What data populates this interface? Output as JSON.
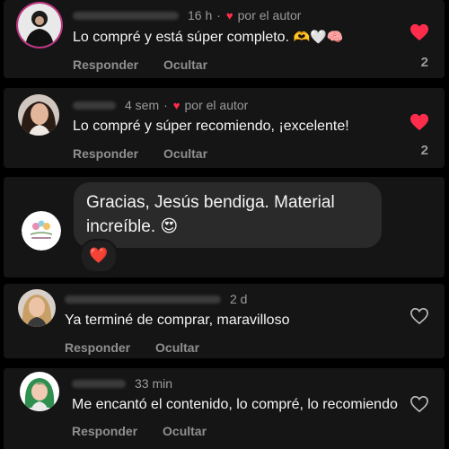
{
  "comments": [
    {
      "time": "16 h",
      "author_note": "por el autor",
      "text": "Lo compré y está súper completo.",
      "emojis": "🫶🤍🧠",
      "reply_label": "Responder",
      "hide_label": "Ocultar",
      "like_count": "2",
      "liked": true,
      "avatar_icon": "profile-photo-woman-black-outfit"
    },
    {
      "time": "4 sem",
      "author_note": "por el autor",
      "text": "Lo compré y súper recomiendo, ¡excelente!",
      "reply_label": "Responder",
      "hide_label": "Ocultar",
      "like_count": "2",
      "liked": true,
      "avatar_icon": "profile-photo-woman-dark-hair"
    }
  ],
  "author_reply": {
    "text": "Gracias, Jesús bendiga. Material increíble.",
    "emoji": "😍",
    "reaction": "❤️",
    "avatar_icon": "brand-logo-floral-icon"
  },
  "comments_below": [
    {
      "time": "2 d",
      "text": "Ya terminé de comprar, maravilloso",
      "reply_label": "Responder",
      "hide_label": "Ocultar",
      "liked": false,
      "avatar_icon": "profile-photo-woman-blonde"
    },
    {
      "time": "33 min",
      "text": "Me encantó el contenido, lo compré, lo recomiendo",
      "reply_label": "Responder",
      "hide_label": "Ocultar",
      "liked": false,
      "avatar_icon": "avatar-illustration-girl-green"
    }
  ],
  "colors": {
    "background": "#000000",
    "card": "#151515",
    "like_red": "#ff2d4b",
    "muted_text": "#9b9b9b",
    "bubble": "#2a2a2a"
  }
}
